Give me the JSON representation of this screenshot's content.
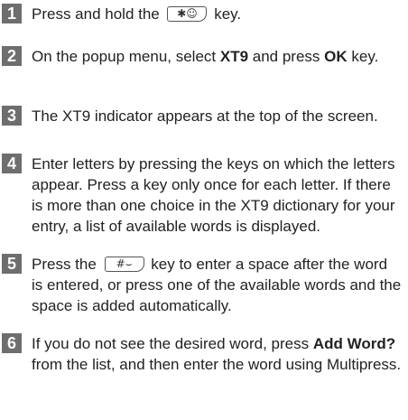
{
  "steps": [
    {
      "number": "1",
      "before": "Press and hold the ",
      "key": "✱☺",
      "after": " key."
    },
    {
      "number": "2",
      "t1": "On the popup menu, select ",
      "b1": "XT9",
      "t2": " and press ",
      "b2": "OK",
      "t3": " key."
    },
    {
      "number": "3",
      "text": "The XT9 indicator appears at the top of the screen."
    },
    {
      "number": "4",
      "text": "Enter letters by pressing the keys on which the letters appear. Press a key only once for each letter. If there is more than one choice in the XT9 dictionary for your entry, a list of available words is displayed."
    },
    {
      "number": "5",
      "before": "Press the ",
      "key": "#⌣",
      "after": " key to enter a space after the word is entered, or press one of the available words and the space is added automatically."
    },
    {
      "number": "6",
      "t1": "If you do not see the desired word, press ",
      "b1": "Add Word?",
      "t2": " from the list, and then enter the word using Multipress."
    }
  ]
}
